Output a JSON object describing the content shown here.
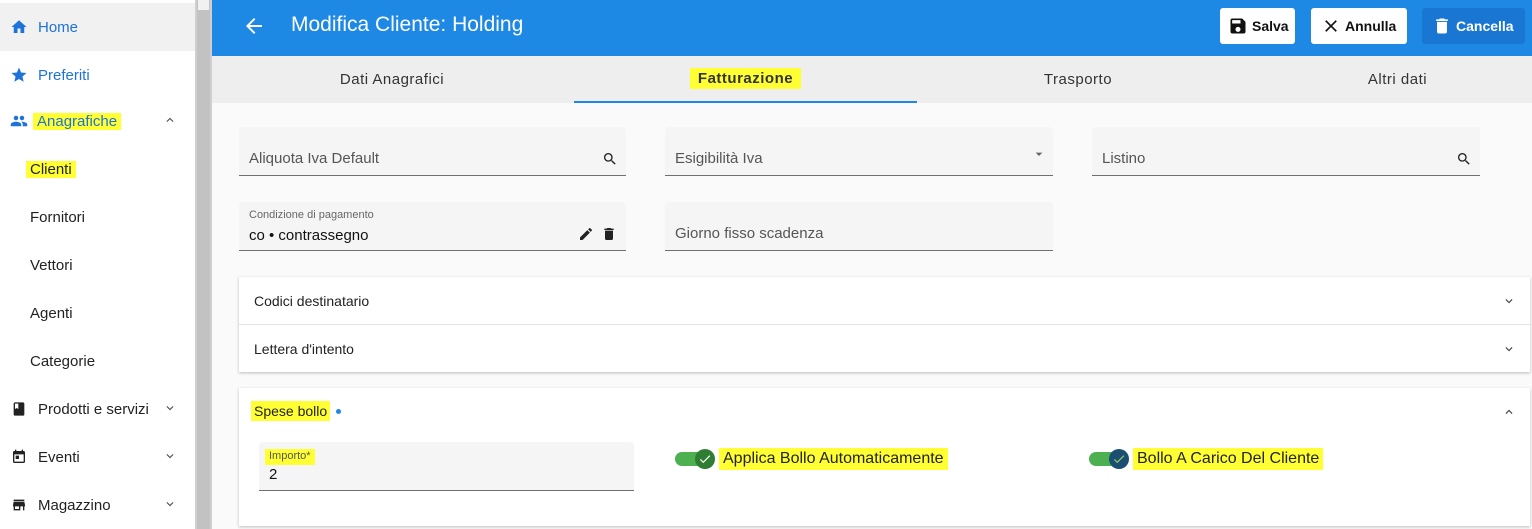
{
  "sidebar": {
    "items": [
      {
        "label": "Home",
        "icon": "home-icon"
      },
      {
        "label": "Preferiti",
        "icon": "star-icon"
      },
      {
        "label": "Anagrafiche",
        "icon": "people-icon"
      },
      {
        "label": "Prodotti e servizi",
        "icon": "book-icon"
      },
      {
        "label": "Eventi",
        "icon": "calendar-icon"
      },
      {
        "label": "Magazzino",
        "icon": "warehouse-icon"
      }
    ],
    "subitems": [
      "Clienti",
      "Fornitori",
      "Vettori",
      "Agenti",
      "Categorie"
    ]
  },
  "header": {
    "title": "Modifica Cliente: Holding",
    "save_label": "Salva",
    "cancel_label": "Annulla",
    "delete_label": "Cancella"
  },
  "tabs": [
    "Dati Anagrafici",
    "Fatturazione",
    "Trasporto",
    "Altri dati"
  ],
  "form": {
    "aliquota_placeholder": "Aliquota Iva Default",
    "esigibilita_placeholder": "Esigibilità Iva",
    "listino_placeholder": "Listino",
    "condizione_label": "Condizione di pagamento",
    "condizione_value": "co • contrassegno",
    "giorno_placeholder": "Giorno fisso scadenza"
  },
  "panels": {
    "codici": "Codici destinatario",
    "lettera": "Lettera d'intento",
    "spese_bollo": "Spese bollo",
    "importo_label": "Importo*",
    "importo_value": "2",
    "applica_bollo": "Applica Bollo Automaticamente",
    "bollo_carico": "Bollo A Carico Del Cliente"
  },
  "colors": {
    "primary": "#1e88e5",
    "highlight": "#ffff33",
    "toggle_on": "#4caf50"
  }
}
